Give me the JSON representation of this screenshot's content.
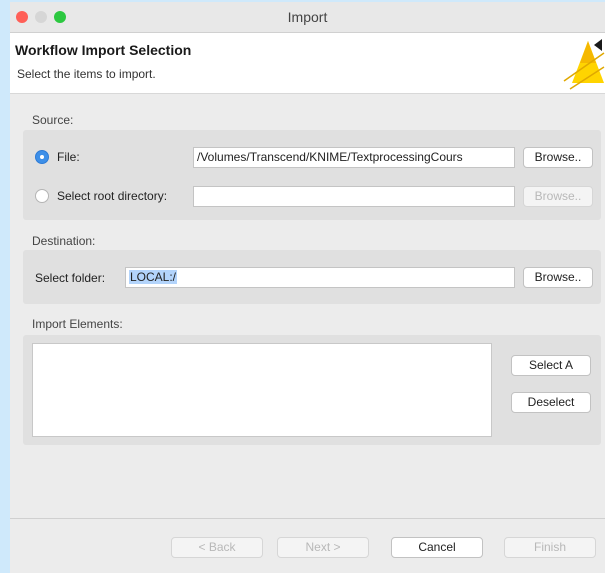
{
  "window": {
    "title": "Import"
  },
  "header": {
    "title": "Workflow Import Selection",
    "subtitle": "Select the items to import."
  },
  "source": {
    "label": "Source:",
    "file_option": {
      "label": "File:",
      "selected": true,
      "value": "/Volumes/Transcend/KNIME/TextprocessingCours",
      "browse": "Browse.."
    },
    "root_option": {
      "label": "Select root directory:",
      "selected": false,
      "value": "",
      "browse": "Browse.."
    }
  },
  "destination": {
    "label": "Destination:",
    "folder_label": "Select folder:",
    "folder_value": "LOCAL:/",
    "browse": "Browse.."
  },
  "import_elements": {
    "label": "Import Elements:",
    "select_all": "Select A",
    "deselect": "Deselect"
  },
  "footer": {
    "back": "< Back",
    "next": "Next >",
    "cancel": "Cancel",
    "finish": "Finish"
  },
  "colors": {
    "accent": "#3d8fe8",
    "selection": "#b3d4fb",
    "background": "#cfe9fb"
  }
}
